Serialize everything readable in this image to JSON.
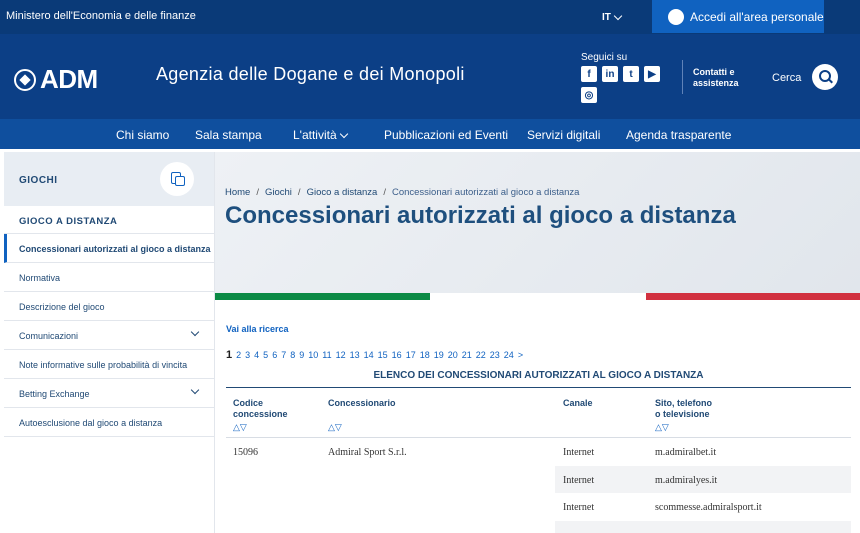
{
  "topbar": {
    "ministry": "Ministero dell'Economia e delle finanze",
    "lang": "IT",
    "login": "Accedi all'area personale"
  },
  "header": {
    "logo": "ADM",
    "title": "Agenzia delle Dogane e dei Monopoli",
    "social_label": "Seguici su",
    "social": [
      "facebook-icon",
      "linkedin-icon",
      "twitter-icon",
      "youtube-icon",
      "instagram-icon"
    ],
    "contacts_line1": "Contatti e",
    "contacts_line2": "assistenza",
    "search_label": "Cerca"
  },
  "nav": {
    "items": [
      "Chi siamo",
      "Sala stampa",
      "L'attività",
      "Pubblicazioni ed Eventi",
      "Servizi digitali",
      "Agenda trasparente"
    ]
  },
  "sidebar": {
    "head": "GIOCHI",
    "sub": "GIOCO A DISTANZA",
    "items": [
      "Concessionari autorizzati al gioco a distanza",
      "Normativa",
      "Descrizione del gioco",
      "Comunicazioni",
      "Note informative sulle probabilità di vincita",
      "Betting Exchange",
      "Autoesclusione dal gioco a distanza"
    ]
  },
  "breadcrumb": [
    "Home",
    "Giochi",
    "Gioco a distanza",
    "Concessionari autorizzati al gioco a distanza"
  ],
  "page_title": "Concessionari autorizzati al gioco a distanza",
  "skip_link": "Vai alla ricerca",
  "pager": {
    "current": "1",
    "pages": [
      "2",
      "3",
      "4",
      "5",
      "6",
      "7",
      "8",
      "9",
      "10",
      "11",
      "12",
      "13",
      "14",
      "15",
      "16",
      "17",
      "18",
      "19",
      "20",
      "21",
      "22",
      "23",
      "24"
    ],
    "next": ">"
  },
  "table": {
    "title": "ELENCO DEI CONCESSIONARI AUTORIZZATI AL GIOCO A DISTANZA",
    "headers": {
      "code_l1": "Codice",
      "code_l2": "concessione",
      "name": "Concessionario",
      "channel": "Canale",
      "site_l1": "Sito, telefono",
      "site_l2": "o televisione"
    },
    "sort_symbol": "△▽",
    "code": "15096",
    "concessionaire": "Admiral Sport S.r.l.",
    "rows": [
      {
        "channel": "Internet",
        "site": "m.admiralbet.it"
      },
      {
        "channel": "Internet",
        "site": "m.admiralyes.it"
      },
      {
        "channel": "Internet",
        "site": "scommesse.admiralsport.it"
      }
    ]
  },
  "colors": {
    "topbar": "#0a3a78",
    "header": "#0c3f86",
    "nav": "#0f4f9e",
    "accent": "#1062c0",
    "flag_green": "#0b8a45",
    "flag_red": "#d1303f"
  }
}
